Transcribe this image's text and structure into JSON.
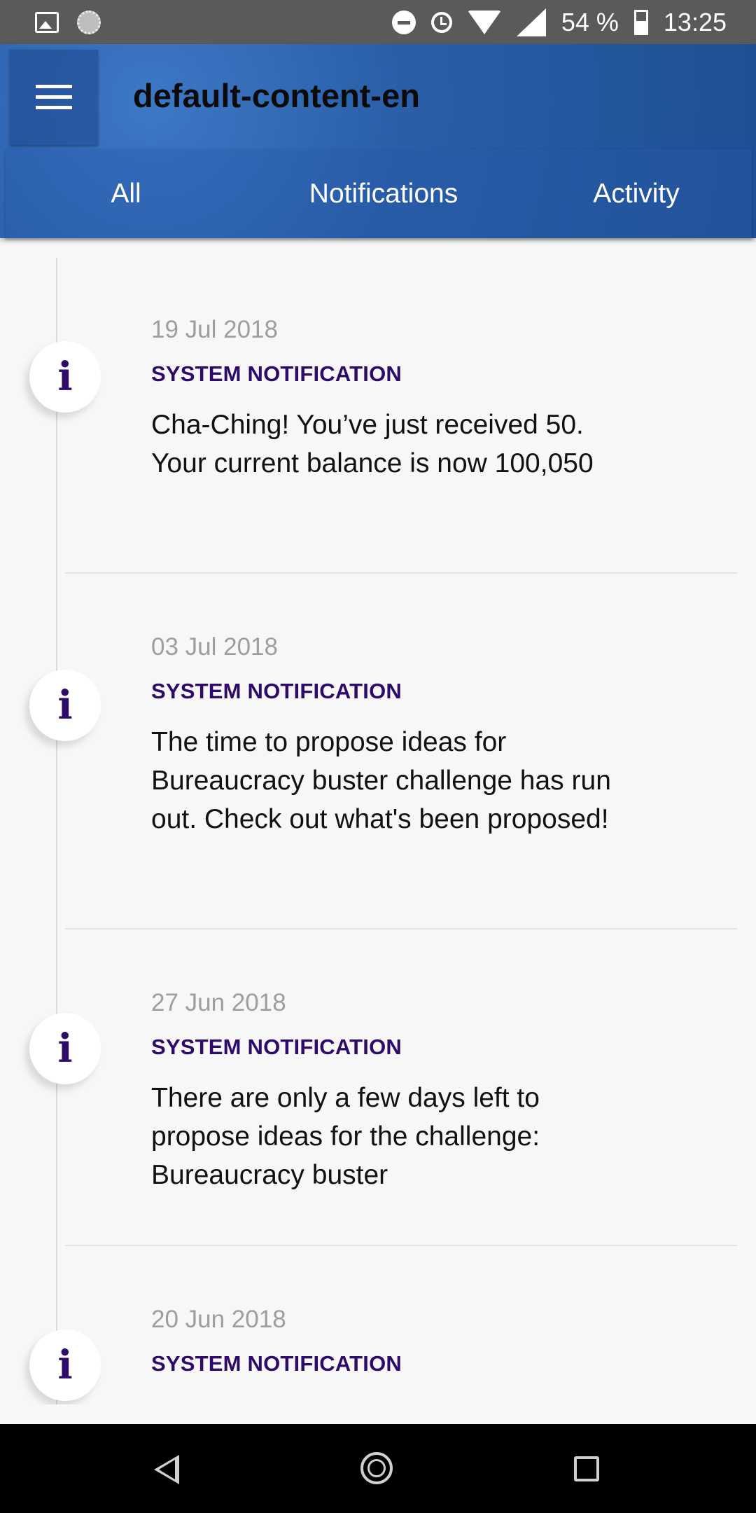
{
  "status_bar": {
    "battery": "54 %",
    "time": "13:25",
    "icons": [
      "picture-icon",
      "loading-icon",
      "do-not-disturb-icon",
      "alarm-icon",
      "wifi-icon",
      "signal-icon",
      "battery-icon"
    ]
  },
  "app_bar": {
    "title": "default-content-en",
    "menu_icon": "hamburger-menu-icon",
    "background_color": "#2a5fa8"
  },
  "tabs": [
    {
      "label": "All"
    },
    {
      "label": "Notifications"
    },
    {
      "label": "Activity"
    }
  ],
  "timeline": {
    "items": [
      {
        "date": "19 Jul 2018",
        "type": "SYSTEM NOTIFICATION",
        "message": "Cha-Ching! You’ve just received 50. Your current balance is now 100,050"
      },
      {
        "date": "03 Jul 2018",
        "type": "SYSTEM NOTIFICATION",
        "message": "The time to propose ideas for Bureaucracy buster challenge has run out.  Check out what's been proposed!"
      },
      {
        "date": "27 Jun 2018",
        "type": "SYSTEM NOTIFICATION",
        "message": "There are only a few days left to propose ideas for the challenge: Bureaucracy buster"
      },
      {
        "date": "20 Jun 2018",
        "type": "SYSTEM NOTIFICATION",
        "message": ""
      }
    ],
    "badge_glyph": "i",
    "accent_color": "#2e0a6a"
  },
  "nav_bar": {
    "icons": [
      "back-icon",
      "home-icon",
      "recent-apps-icon"
    ]
  }
}
